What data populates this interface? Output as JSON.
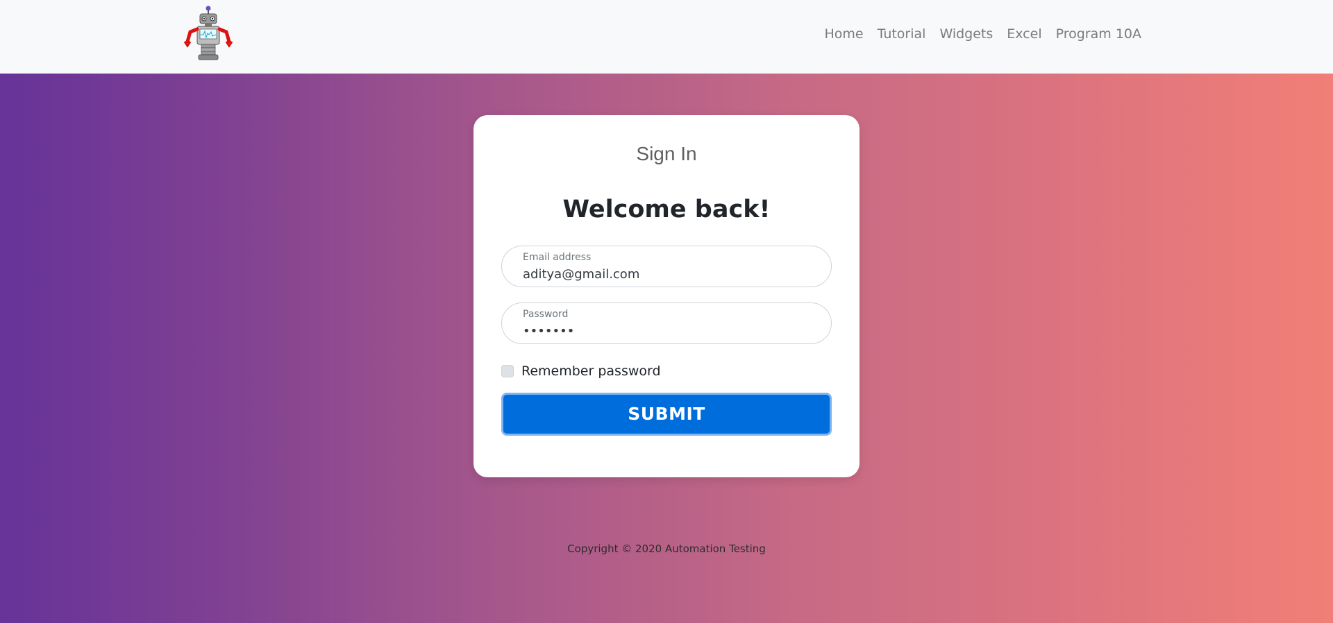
{
  "nav": {
    "logo_icon": "robot-logo-icon",
    "links": [
      "Home",
      "Tutorial",
      "Widgets",
      "Excel",
      "Program 10A"
    ]
  },
  "card": {
    "subtitle": "Sign In",
    "title": "Welcome back!",
    "email": {
      "label": "Email address",
      "value": "aditya@gmail.com"
    },
    "password": {
      "label": "Password",
      "value": "•••••••"
    },
    "remember_label": "Remember password",
    "remember_checked": false,
    "submit_label": "SUBMIT"
  },
  "footer": {
    "copyright": "Copyright © 2020 Automation Testing"
  },
  "colors": {
    "gradient_start": "#673399",
    "gradient_end": "#f17f77",
    "submit_blue": "#006ddc"
  }
}
